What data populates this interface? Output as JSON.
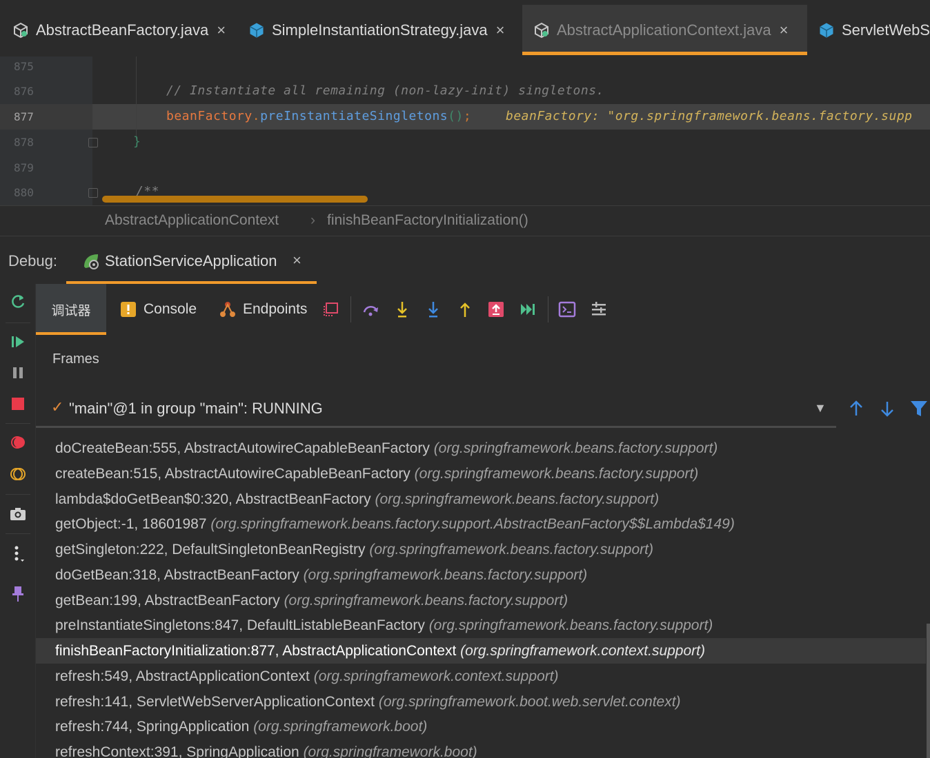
{
  "editor_tabs": [
    {
      "label": "AbstractBeanFactory.java",
      "close": "×",
      "icon": "java-class-icon"
    },
    {
      "label": "SimpleInstantiationStrategy.java",
      "close": "×",
      "icon": "java-class-icon"
    },
    {
      "label": "AbstractApplicationContext.java",
      "close": "×",
      "icon": "java-class-icon"
    },
    {
      "label": "ServletWebSe",
      "icon": "java-class-icon"
    }
  ],
  "code": {
    "line_numbers": [
      "875",
      "876",
      "877",
      "878",
      "879",
      "880"
    ],
    "comment": "// Instantiate all remaining (non-lazy-init) singletons.",
    "call_receiver": "beanFactory",
    "call_dot": ".",
    "call_method": "preInstantiateSingletons",
    "call_parens": "()",
    "call_semicolon": ";",
    "inline_hint": "beanFactory: \"org.springframework.beans.factory.supp",
    "closing_brace": "}",
    "javadoc_start": "/**"
  },
  "breadcrumb": {
    "class_name": "AbstractApplicationContext",
    "separator": "›",
    "method_name": "finishBeanFactoryInitialization()"
  },
  "debug": {
    "label": "Debug:",
    "session_name": "StationServiceApplication",
    "session_close": "×"
  },
  "subtabs": {
    "debugger": "调试器",
    "console": "Console",
    "endpoints": "Endpoints"
  },
  "frames": {
    "title": "Frames",
    "thread_check": "✓",
    "thread": "\"main\"@1 in group \"main\": RUNNING",
    "dropdown": "▼",
    "items": [
      {
        "method": "doCreateBean:555, AbstractAutowireCapableBeanFactory",
        "pkg": "(org.springframework.beans.factory.support)"
      },
      {
        "method": "createBean:515, AbstractAutowireCapableBeanFactory",
        "pkg": "(org.springframework.beans.factory.support)"
      },
      {
        "method": "lambda$doGetBean$0:320, AbstractBeanFactory",
        "pkg": "(org.springframework.beans.factory.support)"
      },
      {
        "method": "getObject:-1, 18601987",
        "pkg": "(org.springframework.beans.factory.support.AbstractBeanFactory$$Lambda$149)"
      },
      {
        "method": "getSingleton:222, DefaultSingletonBeanRegistry",
        "pkg": "(org.springframework.beans.factory.support)"
      },
      {
        "method": "doGetBean:318, AbstractBeanFactory",
        "pkg": "(org.springframework.beans.factory.support)"
      },
      {
        "method": "getBean:199, AbstractBeanFactory",
        "pkg": "(org.springframework.beans.factory.support)"
      },
      {
        "method": "preInstantiateSingletons:847, DefaultListableBeanFactory",
        "pkg": "(org.springframework.beans.factory.support)"
      },
      {
        "method": "finishBeanFactoryInitialization:877, AbstractApplicationContext",
        "pkg": "(org.springframework.context.support)"
      },
      {
        "method": "refresh:549, AbstractApplicationContext",
        "pkg": "(org.springframework.context.support)"
      },
      {
        "method": "refresh:141, ServletWebServerApplicationContext",
        "pkg": "(org.springframework.boot.web.servlet.context)"
      },
      {
        "method": "refresh:744, SpringApplication",
        "pkg": "(org.springframework.boot)"
      },
      {
        "method": "refreshContext:391, SpringApplication",
        "pkg": "(org.springframework.boot)"
      }
    ]
  },
  "colors": {
    "accent_orange": "#f09a2b",
    "debug_green": "#4fc08d",
    "stop_red": "#e83a4a",
    "step_yellow": "#e6c229",
    "step_blue": "#3f8ae0"
  }
}
